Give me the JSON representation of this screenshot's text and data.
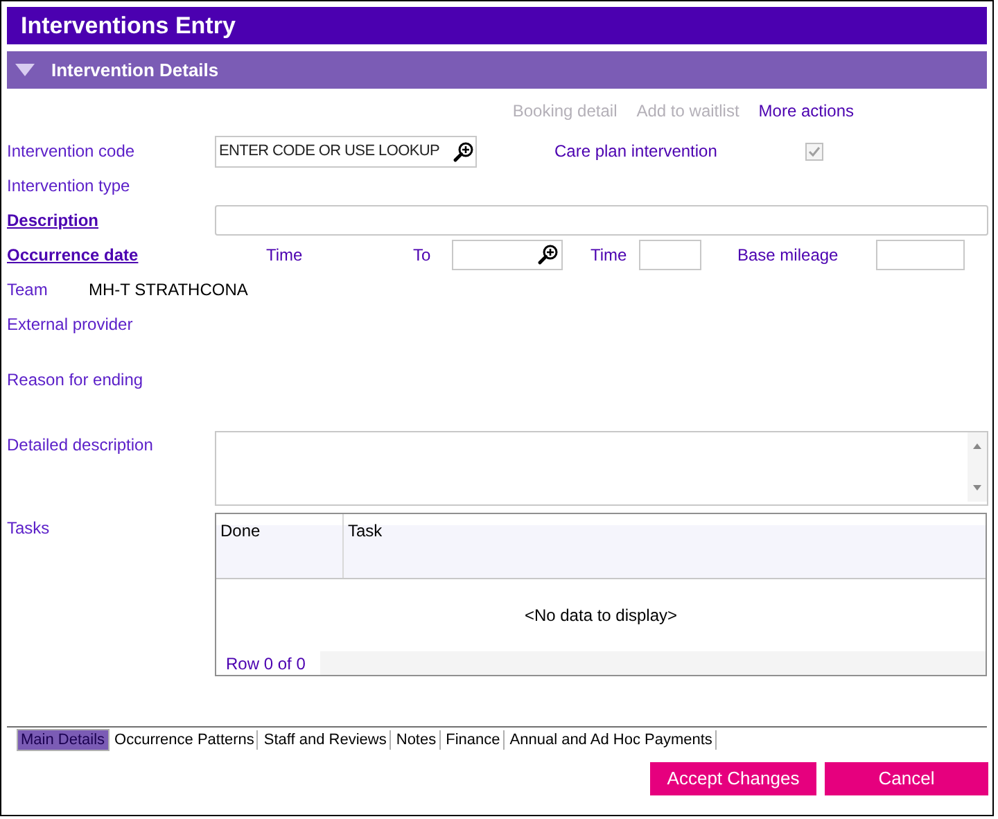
{
  "window": {
    "title": "Interventions Entry"
  },
  "section": {
    "title": "Intervention Details",
    "expanded": true
  },
  "actions": [
    {
      "label": "Booking detail",
      "disabled": true
    },
    {
      "label": "Add to waitlist",
      "disabled": true
    },
    {
      "label": "More actions",
      "disabled": false
    }
  ],
  "intervention_code": {
    "label": {
      "text": "Intervention code",
      "required": false
    },
    "placeholder": "ENTER CODE OR USE LOOKUP"
  },
  "care_plan_intervention": {
    "label": "Care plan intervention",
    "checked": true,
    "disabled": true
  },
  "intervention_type": {
    "label": {
      "text": "Intervention type",
      "required": false
    }
  },
  "description": {
    "label": {
      "text": "Description",
      "required": true
    }
  },
  "occurrence_date": {
    "label": {
      "text": "Occurrence date",
      "required": true
    },
    "time_label": "Time",
    "to_label": "To",
    "to_time_label": "Time",
    "base_mileage_label": "Base mileage"
  },
  "team": {
    "label": {
      "text": "Team",
      "required": false
    },
    "value": "MH-T STRATHCONA"
  },
  "external_provider": {
    "label": {
      "text": "External provider",
      "required": false
    }
  },
  "reason_for_ending": {
    "label": {
      "text": "Reason for ending",
      "required": false
    }
  },
  "detailed_description": {
    "label": {
      "text": "Detailed description",
      "required": false
    }
  },
  "tasks": {
    "label": {
      "text": "Tasks",
      "required": false
    },
    "columns": [
      "Done",
      "Task"
    ],
    "empty_text": "<No data to display>",
    "footer": "Row 0 of 0"
  },
  "tabs": [
    {
      "label": "Main Details",
      "selected": true
    },
    {
      "label": "Occurrence Patterns",
      "selected": false
    },
    {
      "label": "Staff and Reviews",
      "selected": false
    },
    {
      "label": "Notes",
      "selected": false
    },
    {
      "label": "Finance",
      "selected": false
    },
    {
      "label": "Annual and Ad Hoc Payments",
      "selected": false
    }
  ],
  "buttons": [
    "Accept Changes",
    "Cancel"
  ]
}
